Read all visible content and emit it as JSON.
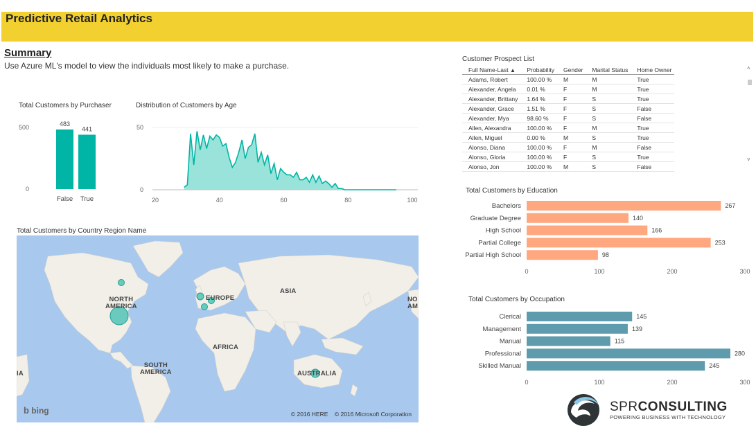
{
  "header": {
    "title": "Predictive Retail Analytics"
  },
  "summary": {
    "title": "Summary",
    "subtitle": "Use Azure ML's model to view the individuals most likely to make a purchase."
  },
  "colors": {
    "banner": "#f2d030",
    "teal": "#00b5a5",
    "teal_area": "#8ee0d6",
    "salmon": "#ffa77f",
    "slate": "#5e9bad"
  },
  "chart_data": [
    {
      "id": "purchaser",
      "type": "bar",
      "title": "Total Customers by Purchaser",
      "categories": [
        "False",
        "True"
      ],
      "values": [
        483,
        441
      ],
      "yticks": [
        0,
        500
      ],
      "ylim": [
        0,
        500
      ],
      "color": "#00b5a5"
    },
    {
      "id": "age",
      "type": "area",
      "title": "Distribution of Customers by Age",
      "x": [
        29,
        30,
        31,
        32,
        33,
        34,
        35,
        36,
        37,
        38,
        39,
        40,
        41,
        42,
        43,
        44,
        45,
        46,
        47,
        48,
        49,
        50,
        51,
        52,
        53,
        54,
        55,
        56,
        57,
        58,
        59,
        60,
        61,
        62,
        63,
        64,
        65,
        66,
        67,
        68,
        69,
        70,
        71,
        72,
        73,
        74,
        75,
        76,
        77,
        78,
        79,
        80,
        85,
        90,
        95
      ],
      "y": [
        2,
        4,
        45,
        20,
        47,
        32,
        44,
        33,
        43,
        40,
        44,
        42,
        35,
        37,
        26,
        18,
        22,
        30,
        40,
        25,
        34,
        36,
        45,
        22,
        30,
        20,
        28,
        13,
        21,
        8,
        17,
        14,
        12,
        12,
        10,
        14,
        8,
        8,
        10,
        6,
        12,
        6,
        11,
        5,
        7,
        5,
        2,
        5,
        1,
        1,
        0,
        0,
        0,
        0,
        0
      ],
      "xticks": [
        20,
        40,
        60,
        80,
        100
      ],
      "yticks": [
        0,
        50
      ],
      "xlim": [
        20,
        100
      ],
      "ylim": [
        0,
        50
      ],
      "color": "#00b5a5"
    },
    {
      "id": "education",
      "type": "bar",
      "title": "Total Customers by Education",
      "categories": [
        "Bachelors",
        "Graduate Degree",
        "High School",
        "Partial College",
        "Partial High School"
      ],
      "values": [
        267,
        140,
        166,
        253,
        98
      ],
      "xticks": [
        0,
        100,
        200,
        300
      ],
      "xlim": [
        0,
        300
      ],
      "color": "#ffa77f"
    },
    {
      "id": "occupation",
      "type": "bar",
      "title": "Total Customers by Occupation",
      "categories": [
        "Clerical",
        "Management",
        "Manual",
        "Professional",
        "Skilled Manual"
      ],
      "values": [
        145,
        139,
        115,
        280,
        245
      ],
      "xticks": [
        0,
        100,
        200,
        300
      ],
      "xlim": [
        0,
        300
      ],
      "color": "#5e9bad"
    }
  ],
  "prospect_list": {
    "title": "Customer Prospect List",
    "columns": [
      "Full Name-Last",
      "Probability",
      "Gender",
      "Marital Status",
      "Home Owner"
    ],
    "sort_indicator": "▲",
    "rows": [
      [
        "Adams, Robert",
        "100.00 %",
        "M",
        "M",
        "True"
      ],
      [
        "Alexander, Angela",
        "0.01 %",
        "F",
        "M",
        "True"
      ],
      [
        "Alexander, Brittany",
        "1.64 %",
        "F",
        "S",
        "True"
      ],
      [
        "Alexander, Grace",
        "1.51 %",
        "F",
        "S",
        "False"
      ],
      [
        "Alexander, Mya",
        "98.60 %",
        "F",
        "S",
        "False"
      ],
      [
        "Allen, Alexandra",
        "100.00 %",
        "F",
        "M",
        "True"
      ],
      [
        "Allen, Miguel",
        "0.00 %",
        "M",
        "S",
        "True"
      ],
      [
        "Alonso, Diana",
        "100.00 %",
        "F",
        "M",
        "False"
      ],
      [
        "Alonso, Gloria",
        "100.00 %",
        "F",
        "S",
        "True"
      ],
      [
        "Alonso, Jon",
        "100.00 %",
        "M",
        "S",
        "False"
      ]
    ]
  },
  "map": {
    "title": "Total Customers by Country Region Name",
    "labels": {
      "north_america": "NORTH\nAMERICA",
      "europe": "EUROPE",
      "asia": "ASIA",
      "africa": "AFRICA",
      "south_america": "SOUTH\nAMERICA",
      "australia": "AUSTRALIA",
      "north_am_edge": "NO\nAM",
      "asia_edge": "IA"
    },
    "bing": "bing",
    "copyright": "© 2016 HERE    © 2016 Microsoft Corporation"
  },
  "logo": {
    "name": "SPR CONSULTING",
    "name_bold": "SPR",
    "name_rest": "CONSULTING",
    "tagline": "POWERING BUSINESS WITH TECHNOLOGY"
  }
}
